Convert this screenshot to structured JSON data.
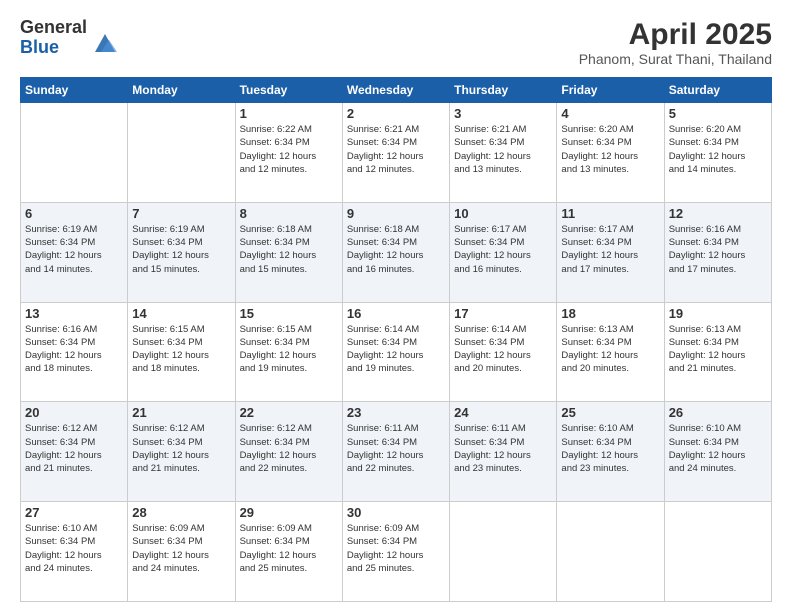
{
  "logo": {
    "general": "General",
    "blue": "Blue"
  },
  "header": {
    "title": "April 2025",
    "subtitle": "Phanom, Surat Thani, Thailand"
  },
  "days_of_week": [
    "Sunday",
    "Monday",
    "Tuesday",
    "Wednesday",
    "Thursday",
    "Friday",
    "Saturday"
  ],
  "weeks": [
    [
      {
        "day": "",
        "detail": ""
      },
      {
        "day": "",
        "detail": ""
      },
      {
        "day": "1",
        "detail": "Sunrise: 6:22 AM\nSunset: 6:34 PM\nDaylight: 12 hours\nand 12 minutes."
      },
      {
        "day": "2",
        "detail": "Sunrise: 6:21 AM\nSunset: 6:34 PM\nDaylight: 12 hours\nand 12 minutes."
      },
      {
        "day": "3",
        "detail": "Sunrise: 6:21 AM\nSunset: 6:34 PM\nDaylight: 12 hours\nand 13 minutes."
      },
      {
        "day": "4",
        "detail": "Sunrise: 6:20 AM\nSunset: 6:34 PM\nDaylight: 12 hours\nand 13 minutes."
      },
      {
        "day": "5",
        "detail": "Sunrise: 6:20 AM\nSunset: 6:34 PM\nDaylight: 12 hours\nand 14 minutes."
      }
    ],
    [
      {
        "day": "6",
        "detail": "Sunrise: 6:19 AM\nSunset: 6:34 PM\nDaylight: 12 hours\nand 14 minutes."
      },
      {
        "day": "7",
        "detail": "Sunrise: 6:19 AM\nSunset: 6:34 PM\nDaylight: 12 hours\nand 15 minutes."
      },
      {
        "day": "8",
        "detail": "Sunrise: 6:18 AM\nSunset: 6:34 PM\nDaylight: 12 hours\nand 15 minutes."
      },
      {
        "day": "9",
        "detail": "Sunrise: 6:18 AM\nSunset: 6:34 PM\nDaylight: 12 hours\nand 16 minutes."
      },
      {
        "day": "10",
        "detail": "Sunrise: 6:17 AM\nSunset: 6:34 PM\nDaylight: 12 hours\nand 16 minutes."
      },
      {
        "day": "11",
        "detail": "Sunrise: 6:17 AM\nSunset: 6:34 PM\nDaylight: 12 hours\nand 17 minutes."
      },
      {
        "day": "12",
        "detail": "Sunrise: 6:16 AM\nSunset: 6:34 PM\nDaylight: 12 hours\nand 17 minutes."
      }
    ],
    [
      {
        "day": "13",
        "detail": "Sunrise: 6:16 AM\nSunset: 6:34 PM\nDaylight: 12 hours\nand 18 minutes."
      },
      {
        "day": "14",
        "detail": "Sunrise: 6:15 AM\nSunset: 6:34 PM\nDaylight: 12 hours\nand 18 minutes."
      },
      {
        "day": "15",
        "detail": "Sunrise: 6:15 AM\nSunset: 6:34 PM\nDaylight: 12 hours\nand 19 minutes."
      },
      {
        "day": "16",
        "detail": "Sunrise: 6:14 AM\nSunset: 6:34 PM\nDaylight: 12 hours\nand 19 minutes."
      },
      {
        "day": "17",
        "detail": "Sunrise: 6:14 AM\nSunset: 6:34 PM\nDaylight: 12 hours\nand 20 minutes."
      },
      {
        "day": "18",
        "detail": "Sunrise: 6:13 AM\nSunset: 6:34 PM\nDaylight: 12 hours\nand 20 minutes."
      },
      {
        "day": "19",
        "detail": "Sunrise: 6:13 AM\nSunset: 6:34 PM\nDaylight: 12 hours\nand 21 minutes."
      }
    ],
    [
      {
        "day": "20",
        "detail": "Sunrise: 6:12 AM\nSunset: 6:34 PM\nDaylight: 12 hours\nand 21 minutes."
      },
      {
        "day": "21",
        "detail": "Sunrise: 6:12 AM\nSunset: 6:34 PM\nDaylight: 12 hours\nand 21 minutes."
      },
      {
        "day": "22",
        "detail": "Sunrise: 6:12 AM\nSunset: 6:34 PM\nDaylight: 12 hours\nand 22 minutes."
      },
      {
        "day": "23",
        "detail": "Sunrise: 6:11 AM\nSunset: 6:34 PM\nDaylight: 12 hours\nand 22 minutes."
      },
      {
        "day": "24",
        "detail": "Sunrise: 6:11 AM\nSunset: 6:34 PM\nDaylight: 12 hours\nand 23 minutes."
      },
      {
        "day": "25",
        "detail": "Sunrise: 6:10 AM\nSunset: 6:34 PM\nDaylight: 12 hours\nand 23 minutes."
      },
      {
        "day": "26",
        "detail": "Sunrise: 6:10 AM\nSunset: 6:34 PM\nDaylight: 12 hours\nand 24 minutes."
      }
    ],
    [
      {
        "day": "27",
        "detail": "Sunrise: 6:10 AM\nSunset: 6:34 PM\nDaylight: 12 hours\nand 24 minutes."
      },
      {
        "day": "28",
        "detail": "Sunrise: 6:09 AM\nSunset: 6:34 PM\nDaylight: 12 hours\nand 24 minutes."
      },
      {
        "day": "29",
        "detail": "Sunrise: 6:09 AM\nSunset: 6:34 PM\nDaylight: 12 hours\nand 25 minutes."
      },
      {
        "day": "30",
        "detail": "Sunrise: 6:09 AM\nSunset: 6:34 PM\nDaylight: 12 hours\nand 25 minutes."
      },
      {
        "day": "",
        "detail": ""
      },
      {
        "day": "",
        "detail": ""
      },
      {
        "day": "",
        "detail": ""
      }
    ]
  ]
}
